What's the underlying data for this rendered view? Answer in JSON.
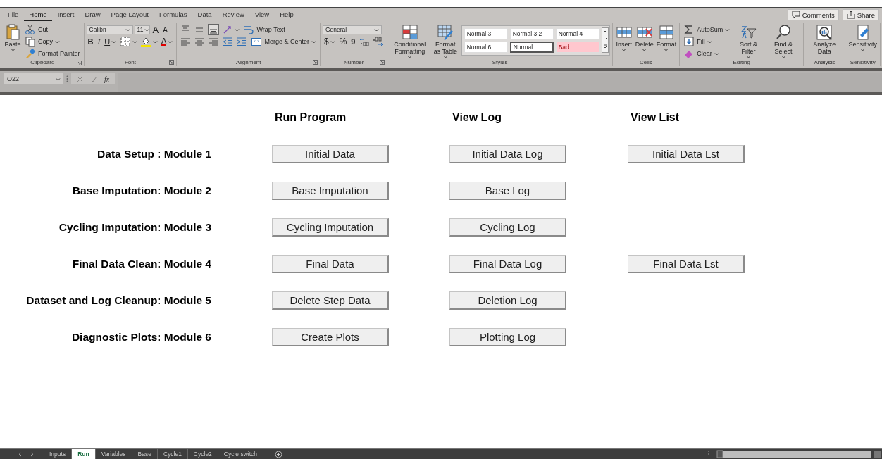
{
  "ribbon": {
    "tabs": [
      {
        "label": "File",
        "selected": false
      },
      {
        "label": "Home",
        "selected": true
      },
      {
        "label": "Insert",
        "selected": false
      },
      {
        "label": "Draw",
        "selected": false
      },
      {
        "label": "Page Layout",
        "selected": false
      },
      {
        "label": "Formulas",
        "selected": false
      },
      {
        "label": "Data",
        "selected": false
      },
      {
        "label": "Review",
        "selected": false
      },
      {
        "label": "View",
        "selected": false
      },
      {
        "label": "Help",
        "selected": false
      }
    ],
    "actions": [
      "Comments",
      "Share"
    ],
    "groups": [
      {
        "label": "Clipboard",
        "launcher": true,
        "columns": [
          {
            "kind": "large",
            "label": "Paste",
            "caret": true
          },
          {
            "kind": "stack",
            "rows": [
              {
                "items": [
                  {
                    "kind": "small",
                    "label": "Cut"
                  }
                ]
              },
              {
                "items": [
                  {
                    "kind": "small",
                    "label": "Copy",
                    "caret": true
                  }
                ]
              },
              {
                "items": [
                  {
                    "kind": "small",
                    "label": "Format Painter"
                  }
                ]
              }
            ]
          }
        ]
      },
      {
        "label": "Font",
        "launcher": true,
        "columns": [
          {
            "kind": "stack",
            "rows": [
              {
                "items": [
                  {
                    "kind": "field",
                    "label": "Calibri"
                  },
                  {
                    "kind": "field",
                    "label": "11"
                  },
                  {
                    "kind": "grow",
                    "label": "A"
                  },
                  {
                    "kind": "shrink",
                    "label": "A"
                  }
                ]
              },
              {
                "items": [
                  {
                    "kind": "bold",
                    "label": "B"
                  },
                  {
                    "kind": "italic",
                    "label": "I"
                  },
                  {
                    "kind": "underline",
                    "label": "U",
                    "caret": true
                  },
                  {
                    "kind": "icon",
                    "caret": true
                  },
                  {
                    "kind": "icon",
                    "caret": true
                  },
                  {
                    "kind": "color",
                    "label": "A",
                    "caret": true
                  }
                ]
              }
            ]
          }
        ]
      },
      {
        "label": "Alignment",
        "launcher": true,
        "columns": [
          {
            "kind": "stack",
            "rows": [
              {
                "items": [
                  {
                    "kind": "icon"
                  },
                  {
                    "kind": "icon"
                  },
                  {
                    "kind": "icon"
                  },
                  {
                    "kind": "icon",
                    "caret": true
                  },
                  {
                    "kind": "small",
                    "label": "Wrap Text"
                  }
                ]
              },
              {
                "items": [
                  {
                    "kind": "icon"
                  },
                  {
                    "kind": "icon"
                  },
                  {
                    "kind": "icon"
                  },
                  {
                    "kind": "icon"
                  },
                  {
                    "kind": "icon"
                  },
                  {
                    "kind": "small",
                    "label": "Merge & Center",
                    "caret": true
                  }
                ]
              }
            ]
          }
        ]
      },
      {
        "label": "Number",
        "launcher": true,
        "columns": [
          {
            "kind": "stack",
            "rows": [
              {
                "items": [
                  {
                    "kind": "field",
                    "label": "General"
                  }
                ]
              },
              {
                "items": [
                  {
                    "kind": "currency",
                    "label": "$",
                    "caret": true
                  },
                  {
                    "kind": "percent",
                    "label": "%"
                  },
                  {
                    "kind": "comma",
                    "label": "9"
                  },
                  {
                    "kind": "icon"
                  },
                  {
                    "kind": "icon"
                  }
                ]
              }
            ]
          }
        ]
      },
      {
        "label": "Styles",
        "columns": [
          {
            "kind": "large",
            "label": "Conditional Formatting",
            "caret": true
          },
          {
            "kind": "large",
            "label": "Format as Table",
            "caret": true
          },
          {
            "kind": "gallery",
            "cells": [
              {
                "label": "Normal 3",
                "kind": "normal",
                "selected": false
              },
              {
                "label": "Normal 3 2",
                "kind": "normal",
                "selected": false
              },
              {
                "label": "Normal 4",
                "kind": "normal",
                "selected": false
              },
              {
                "label": "Normal 6",
                "kind": "normal",
                "selected": false
              },
              {
                "label": "Normal",
                "kind": "normal",
                "selected": true
              },
              {
                "label": "Bad",
                "kind": "bad",
                "selected": false
              }
            ]
          }
        ]
      },
      {
        "label": "Cells",
        "columns": [
          {
            "kind": "large",
            "label": "Insert",
            "caret": true
          },
          {
            "kind": "large",
            "label": "Delete",
            "caret": true
          },
          {
            "kind": "large",
            "label": "Format",
            "caret": true
          }
        ]
      },
      {
        "label": "Editing",
        "columns": [
          {
            "kind": "stack",
            "rows": [
              {
                "items": [
                  {
                    "kind": "small",
                    "label": "AutoSum",
                    "caret": true
                  }
                ]
              },
              {
                "items": [
                  {
                    "kind": "small",
                    "label": "Fill",
                    "caret": true
                  }
                ]
              },
              {
                "items": [
                  {
                    "kind": "small",
                    "label": "Clear",
                    "caret": true
                  }
                ]
              }
            ]
          },
          {
            "kind": "large",
            "label": "Sort & Filter",
            "caret": true
          },
          {
            "kind": "large",
            "label": "Find & Select",
            "caret": true
          }
        ]
      },
      {
        "label": "Analysis",
        "columns": [
          {
            "kind": "large",
            "label": "Analyze Data"
          }
        ]
      },
      {
        "label": "Sensitivity",
        "columns": [
          {
            "kind": "large",
            "label": "Sensitivity",
            "caret": true
          }
        ]
      }
    ]
  },
  "formula_bar": {
    "name_box": "O22",
    "function_label": "fx"
  },
  "sheet": {
    "headings": [
      "Run Program",
      "View Log",
      "View List"
    ],
    "rows": [
      {
        "label": "Data Setup : Module 1",
        "program": "Initial Data",
        "log": "Initial Data Log",
        "list": "Initial Data Lst"
      },
      {
        "label": "Base Imputation: Module 2",
        "program": "Base Imputation",
        "log": "Base Log"
      },
      {
        "label": "Cycling Imputation: Module 3",
        "program": "Cycling Imputation",
        "log": "Cycling Log"
      },
      {
        "label": "Final Data Clean: Module 4",
        "program": "Final Data",
        "log": "Final Data Log",
        "list": "Final Data Lst"
      },
      {
        "label": "Dataset and Log Cleanup: Module 5",
        "program": "Delete Step Data",
        "log": "Deletion Log"
      },
      {
        "label": "Diagnostic Plots: Module 6",
        "program": "Create Plots",
        "log": "Plotting Log"
      }
    ]
  },
  "sheet_tabs": [
    {
      "label": "Inputs",
      "selected": false
    },
    {
      "label": "Run",
      "selected": true
    },
    {
      "label": "Variables",
      "selected": false
    },
    {
      "label": "Base",
      "selected": false
    },
    {
      "label": "Cycle1",
      "selected": false
    },
    {
      "label": "Cycle2",
      "selected": false
    },
    {
      "label": "Cycle switch",
      "selected": false
    }
  ]
}
